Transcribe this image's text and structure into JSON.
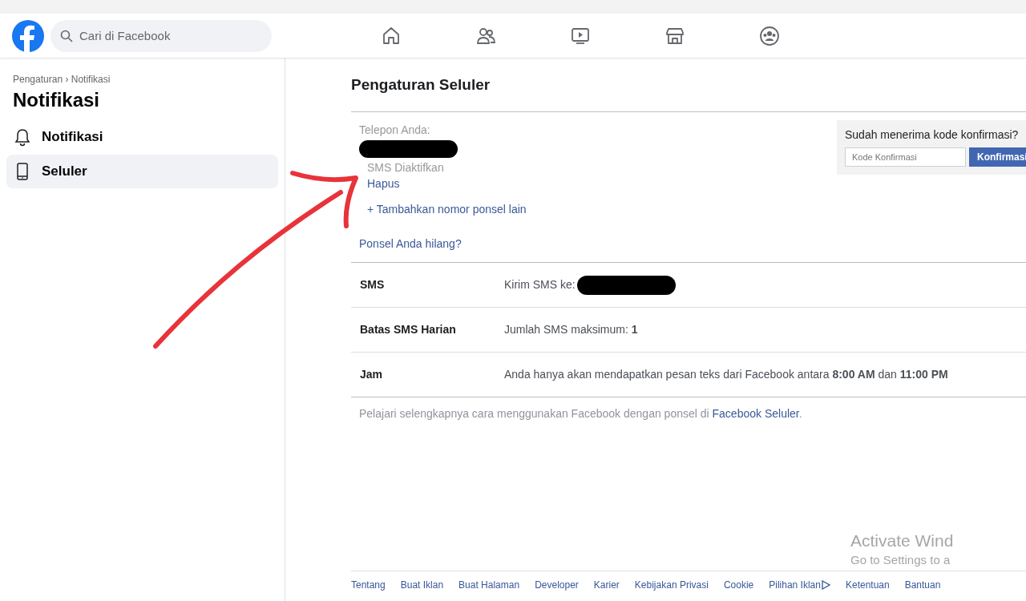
{
  "header": {
    "search": {
      "placeholder": "Cari di Facebook"
    },
    "nav": [
      {
        "kind": "home",
        "selected": false
      },
      {
        "kind": "friends",
        "selected": false
      },
      {
        "kind": "video",
        "selected": false
      },
      {
        "kind": "market",
        "selected": false
      },
      {
        "kind": "groups",
        "selected": false
      }
    ]
  },
  "sidebar": {
    "breadcrumb": "Pengaturan › Notifikasi",
    "title": "Notifikasi",
    "items": [
      {
        "kind": "bell",
        "label": "Notifikasi",
        "selected": false
      },
      {
        "kind": "phone",
        "label": "Seluler",
        "selected": true
      }
    ]
  },
  "main": {
    "title": "Pengaturan Seluler",
    "phone_label": "Telepon Anda:",
    "sms_status": "SMS Diaktifkan",
    "remove_link": "Hapus",
    "add_link": "+ Tambahkan nomor ponsel lain",
    "lost_link": "Ponsel Anda hilang?",
    "confirm": {
      "question": "Sudah menerima kode konfirmasi?",
      "placeholder": "Kode Konfirmasi",
      "button": "Konfirmasi"
    },
    "rows": [
      {
        "label": "SMS",
        "value": "Kirim SMS ke:",
        "redacted": true
      },
      {
        "label": "Batas SMS Harian",
        "value": "Jumlah SMS maksimum: **1**",
        "redacted": false
      },
      {
        "label": "Jam",
        "value": "Anda hanya akan mendapatkan pesan teks dari Facebook antara **8:00 AM** dan **11:00 PM**",
        "redacted": false
      }
    ],
    "note": "Pelajari selengkapnya cara menggunakan Facebook dengan ponsel di",
    "note_link": "Facebook Seluler",
    "note_end": "."
  },
  "footer": [
    "Tentang",
    "Buat Iklan",
    "Buat Halaman",
    "Developer",
    "Karier",
    "Kebijakan Privasi",
    "Cookie",
    "Pilihan Iklan",
    "Ketentuan",
    "Bantuan"
  ],
  "os_notice": {
    "title": "Activate Wind",
    "subtitle": "Go to Settings to a"
  }
}
